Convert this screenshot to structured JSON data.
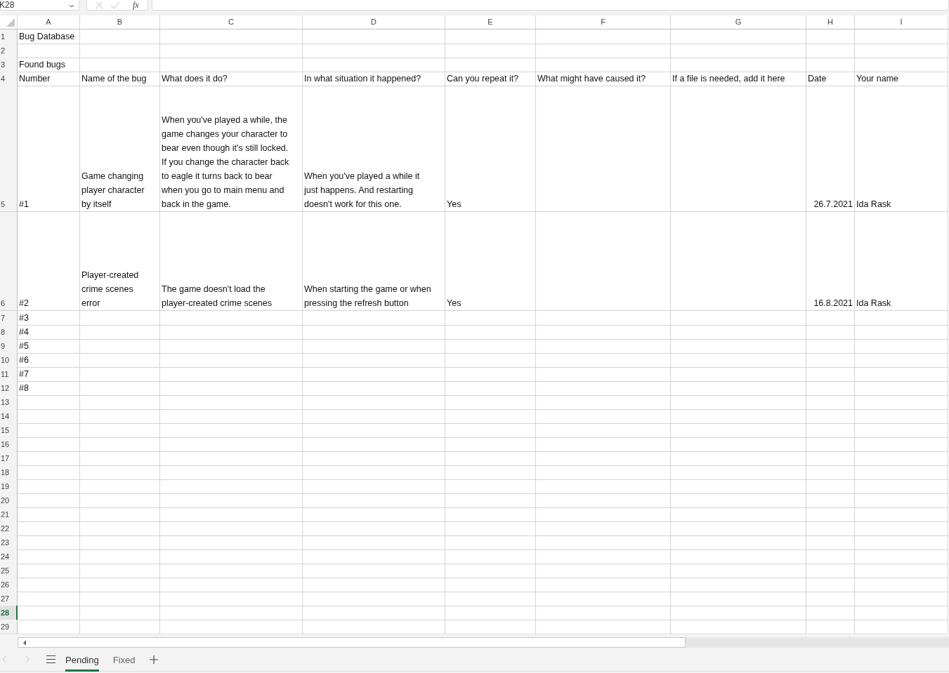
{
  "formula_bar": {
    "name_box": "K28",
    "function_label": "fx"
  },
  "columns": [
    {
      "label": "A",
      "selected": false
    },
    {
      "label": "B",
      "selected": false
    },
    {
      "label": "C",
      "selected": false
    },
    {
      "label": "D",
      "selected": false
    },
    {
      "label": "E",
      "selected": false
    },
    {
      "label": "F",
      "selected": false
    },
    {
      "label": "G",
      "selected": false
    },
    {
      "label": "H",
      "selected": false
    },
    {
      "label": "I",
      "selected": false
    }
  ],
  "rows": [
    {
      "number": "1",
      "selected": false,
      "cells": {
        "A": "Bug Database"
      }
    },
    {
      "number": "2",
      "selected": false
    },
    {
      "number": "3",
      "selected": false,
      "cells": {
        "A": "Found bugs"
      }
    },
    {
      "number": "4",
      "selected": false,
      "cells": {
        "A": "Number",
        "B": "Name of the bug",
        "C": "What does it do?",
        "D": "In what situation it happened?",
        "E": "Can you repeat it?",
        "F": "What might have caused it?",
        "G": "If a file is needed, add it here",
        "H": "Date",
        "I": "Your name"
      }
    },
    {
      "number": "5",
      "selected": false,
      "cells": {
        "A": "#1",
        "B": "Game changing\nplayer character\nby itself",
        "C": "When you've played a while, the\ngame changes your character to\nbear even though it's still locked.\nIf you change the character back\nto eagle it turns back to bear\nwhen you go to main menu and\nback in the game.",
        "D": "When you've played a while it\njust happens. And restarting\ndoesn't work for this one.",
        "E": "Yes",
        "H": {
          "text": "26.7.2021",
          "kind": "number"
        },
        "I": "Ida Rask"
      }
    },
    {
      "number": "6",
      "selected": false,
      "cells": {
        "A": "#2",
        "B": "Player-created\ncrime scenes\nerror",
        "C": "The game doesn't load the\nplayer-created crime scenes",
        "D": "When starting the game or when\npressing the refresh button",
        "E": "Yes",
        "H": {
          "text": "16.8.2021",
          "kind": "number"
        },
        "I": "Ida Rask"
      }
    },
    {
      "number": "7",
      "selected": false,
      "cells": {
        "A": "#3"
      }
    },
    {
      "number": "8",
      "selected": false,
      "cells": {
        "A": "#4"
      }
    },
    {
      "number": "9",
      "selected": false,
      "cells": {
        "A": "#5"
      }
    },
    {
      "number": "10",
      "selected": false,
      "cells": {
        "A": "#6"
      }
    },
    {
      "number": "11",
      "selected": false,
      "cells": {
        "A": "#7"
      }
    },
    {
      "number": "12",
      "selected": false,
      "cells": {
        "A": "#8"
      }
    },
    {
      "number": "13",
      "selected": false
    },
    {
      "number": "14",
      "selected": false
    },
    {
      "number": "15",
      "selected": false
    },
    {
      "number": "16",
      "selected": false
    },
    {
      "number": "17",
      "selected": false
    },
    {
      "number": "18",
      "selected": false
    },
    {
      "number": "19",
      "selected": false
    },
    {
      "number": "20",
      "selected": false
    },
    {
      "number": "21",
      "selected": false
    },
    {
      "number": "22",
      "selected": false
    },
    {
      "number": "23",
      "selected": false
    },
    {
      "number": "24",
      "selected": false
    },
    {
      "number": "25",
      "selected": false
    },
    {
      "number": "26",
      "selected": false
    },
    {
      "number": "27",
      "selected": false
    },
    {
      "number": "28",
      "selected": true
    },
    {
      "number": "29",
      "selected": false
    }
  ],
  "sheet_tabs": [
    {
      "label": "Pending",
      "selected": true
    },
    {
      "label": "Fixed",
      "selected": false
    }
  ]
}
